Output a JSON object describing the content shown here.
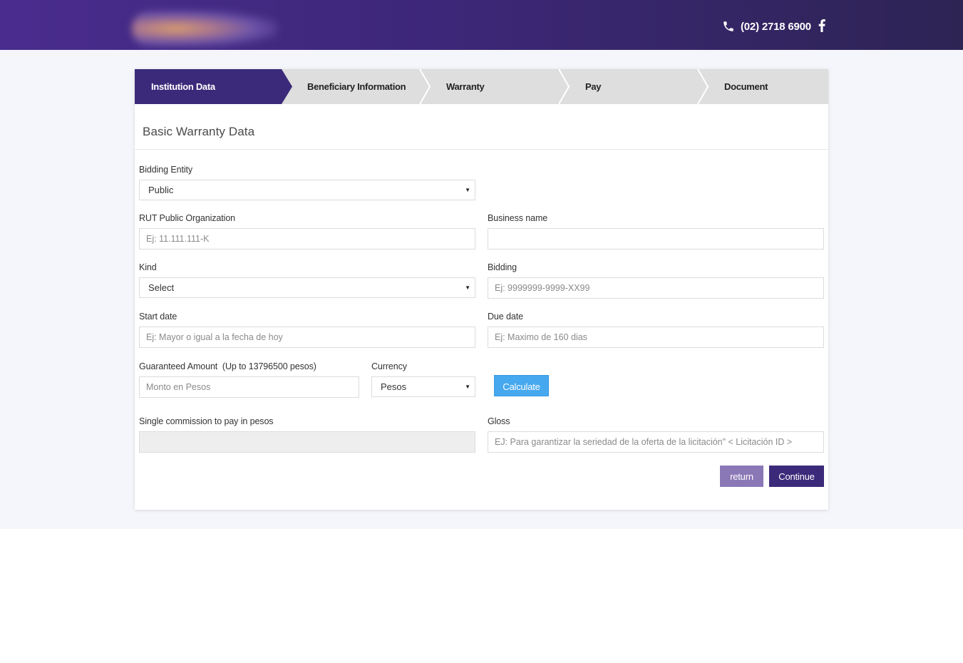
{
  "header": {
    "phone": "(02) 2718 6900",
    "brand_color": "#3d2779"
  },
  "steps": [
    {
      "label": "Institution Data",
      "active": true
    },
    {
      "label": "Beneficiary Information",
      "active": false
    },
    {
      "label": "Warranty",
      "active": false
    },
    {
      "label": "Pay",
      "active": false
    },
    {
      "label": "Document",
      "active": false
    }
  ],
  "form": {
    "title": "Basic Warranty Data",
    "bidding_entity": {
      "label": "Bidding Entity",
      "value": "Public"
    },
    "rut": {
      "label": "RUT Public Organization",
      "placeholder": "Ej: 11.111.111-K"
    },
    "business_name": {
      "label": "Business name",
      "placeholder": ""
    },
    "kind": {
      "label": "Kind",
      "value": "Select"
    },
    "bidding": {
      "label": "Bidding",
      "placeholder": "Ej: 9999999-9999-XX99"
    },
    "start_date": {
      "label": "Start date",
      "placeholder": "Ej: Mayor o igual a la fecha de hoy"
    },
    "due_date": {
      "label": "Due date",
      "placeholder": "Ej: Maximo de 160 dias"
    },
    "amount": {
      "label": "Guaranteed Amount  (Up to 13796500 pesos)",
      "placeholder": "Monto en Pesos"
    },
    "currency": {
      "label": "Currency",
      "value": "Pesos"
    },
    "calculate_label": "Calculate",
    "commission": {
      "label": "Single commission to pay in pesos",
      "value": ""
    },
    "gloss": {
      "label": "Gloss",
      "placeholder": "EJ: Para garantizar la seriedad de la oferta de la licitación\" < Licitación ID >"
    },
    "return_label": "return",
    "continue_label": "Continue"
  },
  "colors": {
    "accent": "#3b2a7a",
    "step_inactive": "#dedede",
    "calculate": "#46a8ee",
    "return": "#8a78b6"
  }
}
